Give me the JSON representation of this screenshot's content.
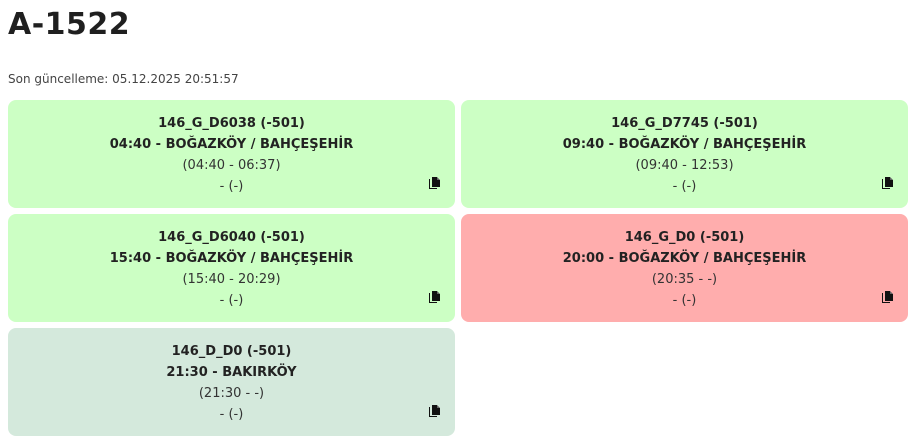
{
  "page": {
    "title": "A-1522",
    "last_update": "Son güncelleme: 05.12.2025 20:51:57"
  },
  "colors": {
    "green": "#ccffc4",
    "red": "#ffadad",
    "gray_green": "#d4e9dc"
  },
  "cards": [
    {
      "code": "146_G_D6038 (-501)",
      "route": "04:40 - BOĞAZKÖY / BAHÇEŞEHİR",
      "times": "(04:40 - 06:37)",
      "extra": "- (-)",
      "status": "green",
      "icon": "copy-icon"
    },
    {
      "code": "146_G_D7745 (-501)",
      "route": "09:40 - BOĞAZKÖY / BAHÇEŞEHİR",
      "times": "(09:40 - 12:53)",
      "extra": "- (-)",
      "status": "green",
      "icon": "copy-icon"
    },
    {
      "code": "146_G_D6040 (-501)",
      "route": "15:40 - BOĞAZKÖY / BAHÇEŞEHİR",
      "times": "(15:40 - 20:29)",
      "extra": "- (-)",
      "status": "green",
      "icon": "copy-icon"
    },
    {
      "code": "146_G_D0 (-501)",
      "route": "20:00 - BOĞAZKÖY / BAHÇEŞEHİR",
      "times": "(20:35 - -)",
      "extra": "- (-)",
      "status": "red",
      "icon": "copy-icon"
    },
    {
      "code": "146_D_D0 (-501)",
      "route": "21:30 - BAKIRKÖY",
      "times": "(21:30 - -)",
      "extra": "- (-)",
      "status": "gray_green",
      "icon": "copy-icon"
    }
  ]
}
